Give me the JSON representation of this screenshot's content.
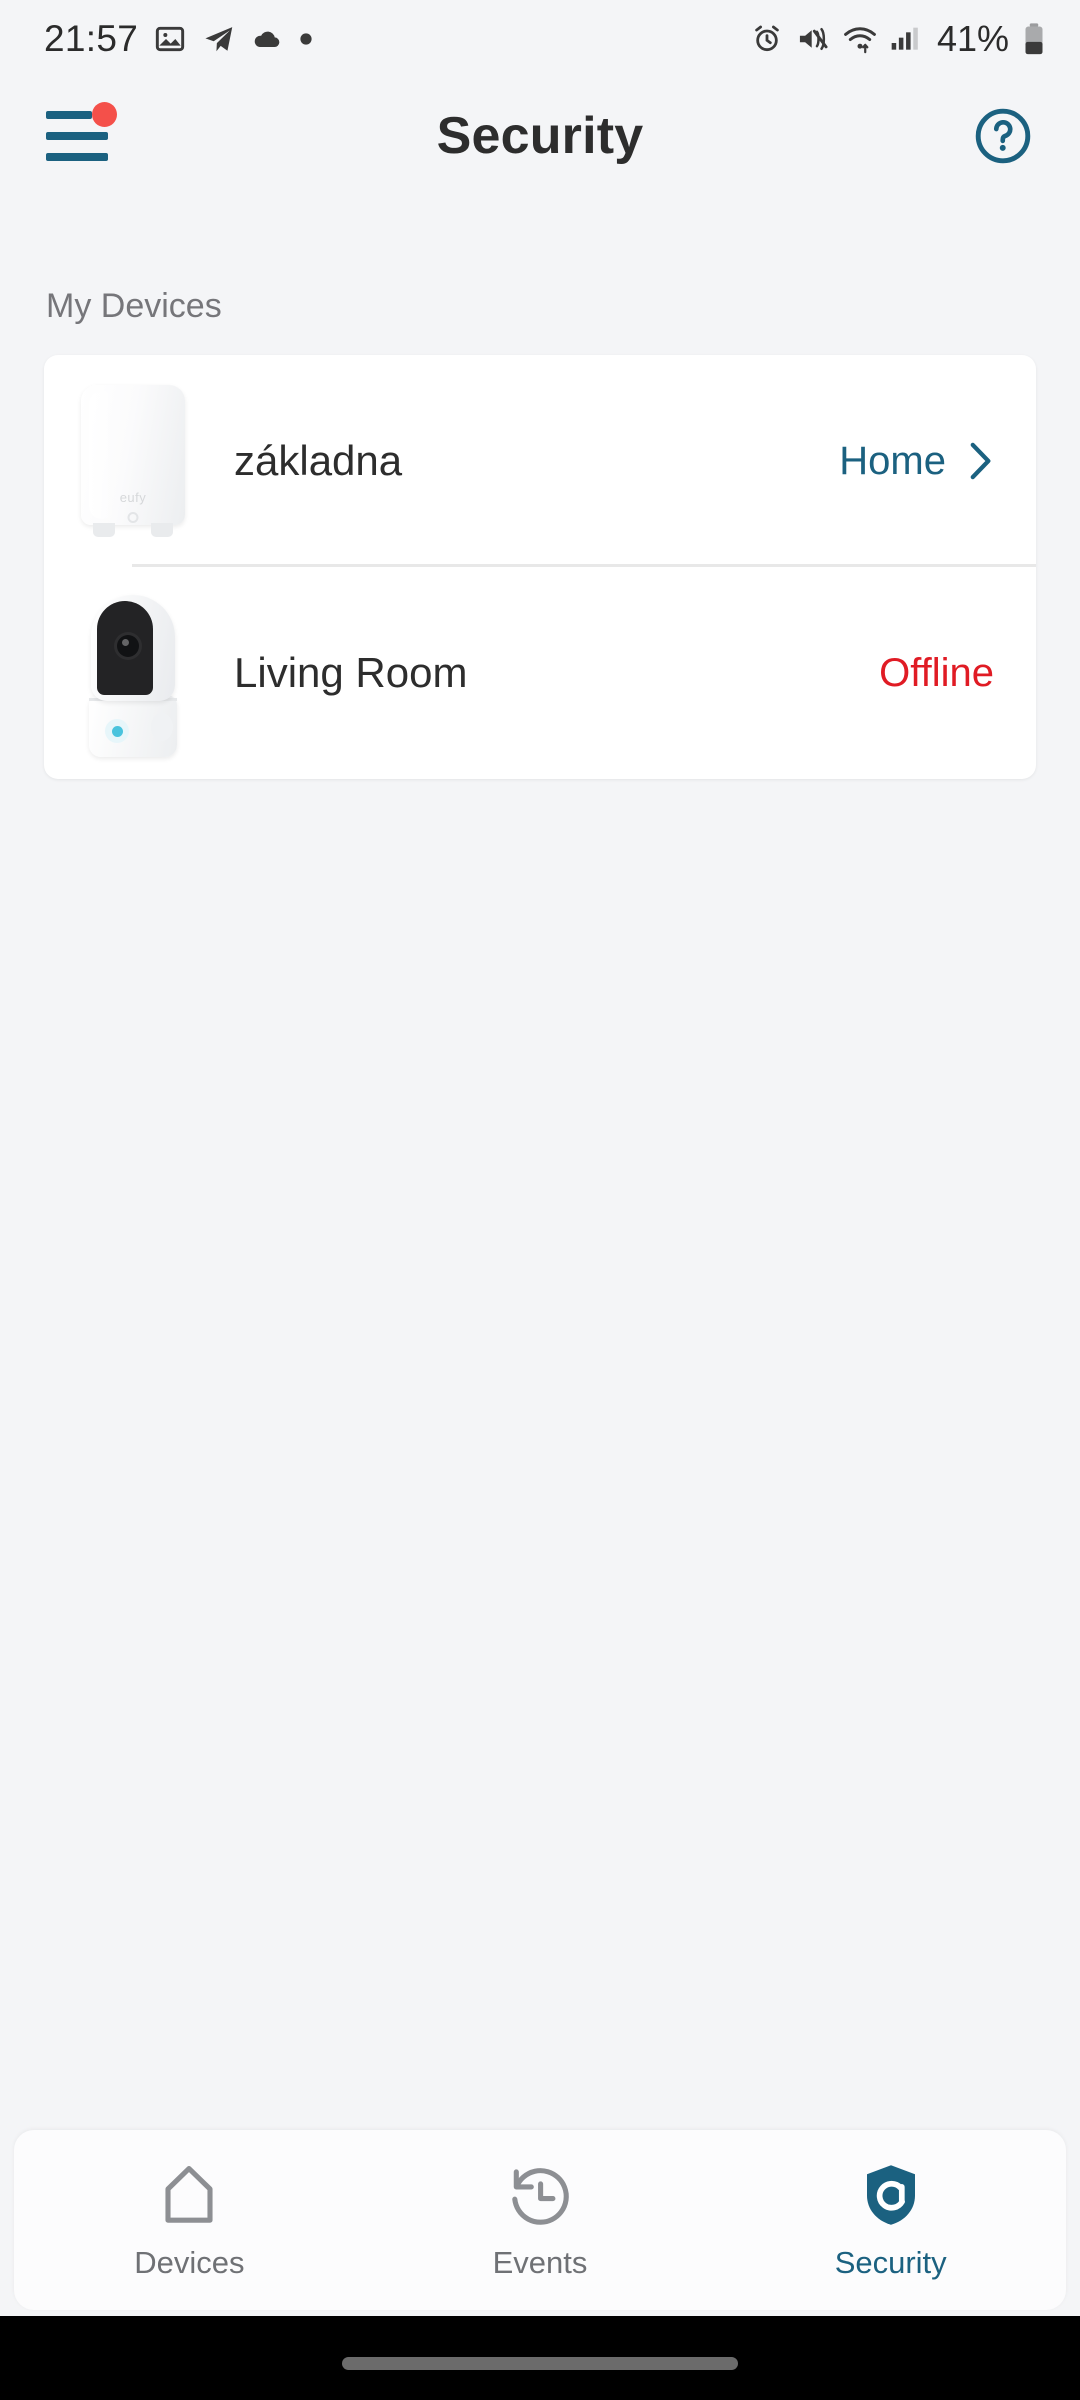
{
  "status_bar": {
    "time": "21:57",
    "battery_percent": "41%",
    "left_icons": [
      "gallery-icon",
      "telegram-icon",
      "cloud-icon",
      "dot-icon"
    ],
    "right_icons": [
      "alarm-icon",
      "vibrate-icon",
      "wifi-icon",
      "signal-icon",
      "battery-icon"
    ]
  },
  "header": {
    "title": "Security",
    "menu_icon": "hamburger-menu-icon",
    "menu_badge": true,
    "help_icon": "help-circle-icon"
  },
  "main": {
    "section_label": "My Devices",
    "devices": [
      {
        "name": "základna",
        "status": "Home",
        "status_type": "link",
        "thumb": "homebase-device-image",
        "chevron": true
      },
      {
        "name": "Living Room",
        "status": "Offline",
        "status_type": "offline",
        "thumb": "indoor-camera-device-image",
        "chevron": false
      }
    ]
  },
  "bottom_nav": {
    "items": [
      {
        "label": "Devices",
        "icon": "home-icon",
        "active": false
      },
      {
        "label": "Events",
        "icon": "history-clock-icon",
        "active": false
      },
      {
        "label": "Security",
        "icon": "shield-icon",
        "active": true
      }
    ]
  },
  "colors": {
    "accent": "#1b6180",
    "offline": "#e01b24",
    "badge": "#f4504a",
    "background": "#f4f5f7",
    "card": "#ffffff"
  }
}
